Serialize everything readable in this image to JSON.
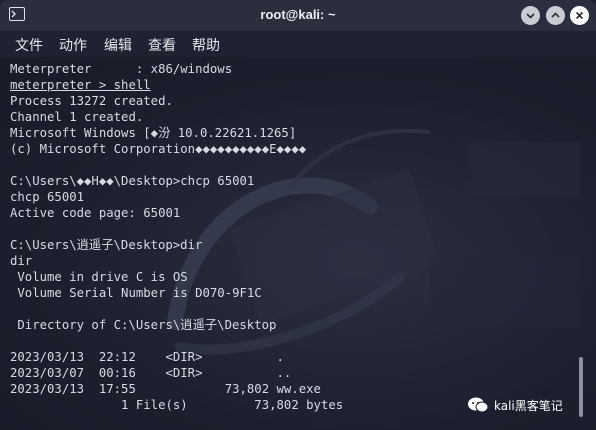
{
  "window": {
    "title": "root@kali: ~"
  },
  "menu": [
    "文件",
    "动作",
    "编辑",
    "查看",
    "帮助"
  ],
  "terminal": {
    "lines": [
      "Meterpreter      : x86/windows",
      "meterpreter > shell",
      "Process 13272 created.",
      "Channel 1 created.",
      "Microsoft Windows [◆汾 10.0.22621.1265]",
      "(c) Microsoft Corporation◆◆◆◆◆◆◆◆◆◆E◆◆◆◆",
      "",
      "C:\\Users\\◆◆H◆◆\\Desktop>chcp 65001",
      "chcp 65001",
      "Active code page: 65001",
      "",
      "C:\\Users\\逍遥子\\Desktop>dir",
      "dir",
      " Volume in drive C is OS",
      " Volume Serial Number is D070-9F1C",
      "",
      " Directory of C:\\Users\\逍遥子\\Desktop",
      "",
      "2023/03/13  22:12    <DIR>          .",
      "2023/03/07  00:16    <DIR>          ..",
      "2023/03/13  17:55            73,802 ww.exe",
      "               1 File(s)         73,802 bytes"
    ]
  },
  "watermark": {
    "text": "kali黑客笔记"
  }
}
